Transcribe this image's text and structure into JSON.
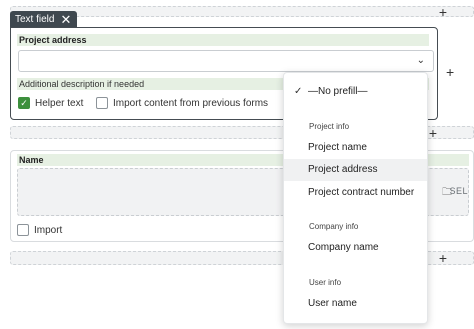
{
  "top_strip": {
    "plus": "+"
  },
  "field_chip": {
    "label": "Text field",
    "close": "✕"
  },
  "field": {
    "label": "Project address",
    "select_value": "",
    "additional_label": "Additional description if needed",
    "helper_text_label": "Helper text",
    "helper_text_checked": true,
    "import_label": "Import content from previous forms",
    "import_checked": false
  },
  "side_controls": {
    "card_plus": "+",
    "strip_plus": "+",
    "lower_plus": "+"
  },
  "name_field": {
    "label": "Name",
    "select_button": "SEL",
    "import_label": "Import",
    "import_checked": false
  },
  "dropdown": {
    "no_prefill": "—No prefill—",
    "groups": [
      {
        "title": "Project info",
        "items": [
          "Project name",
          "Project address",
          "Project contract number"
        ]
      },
      {
        "title": "Company info",
        "items": [
          "Company name"
        ]
      },
      {
        "title": "User info",
        "items": [
          "User name"
        ]
      }
    ],
    "highlighted": "Project address"
  },
  "colors": {
    "chip_bg": "#3f484f",
    "label_bg": "#e6f0e3",
    "checkbox_checked": "#3d8f3d"
  }
}
